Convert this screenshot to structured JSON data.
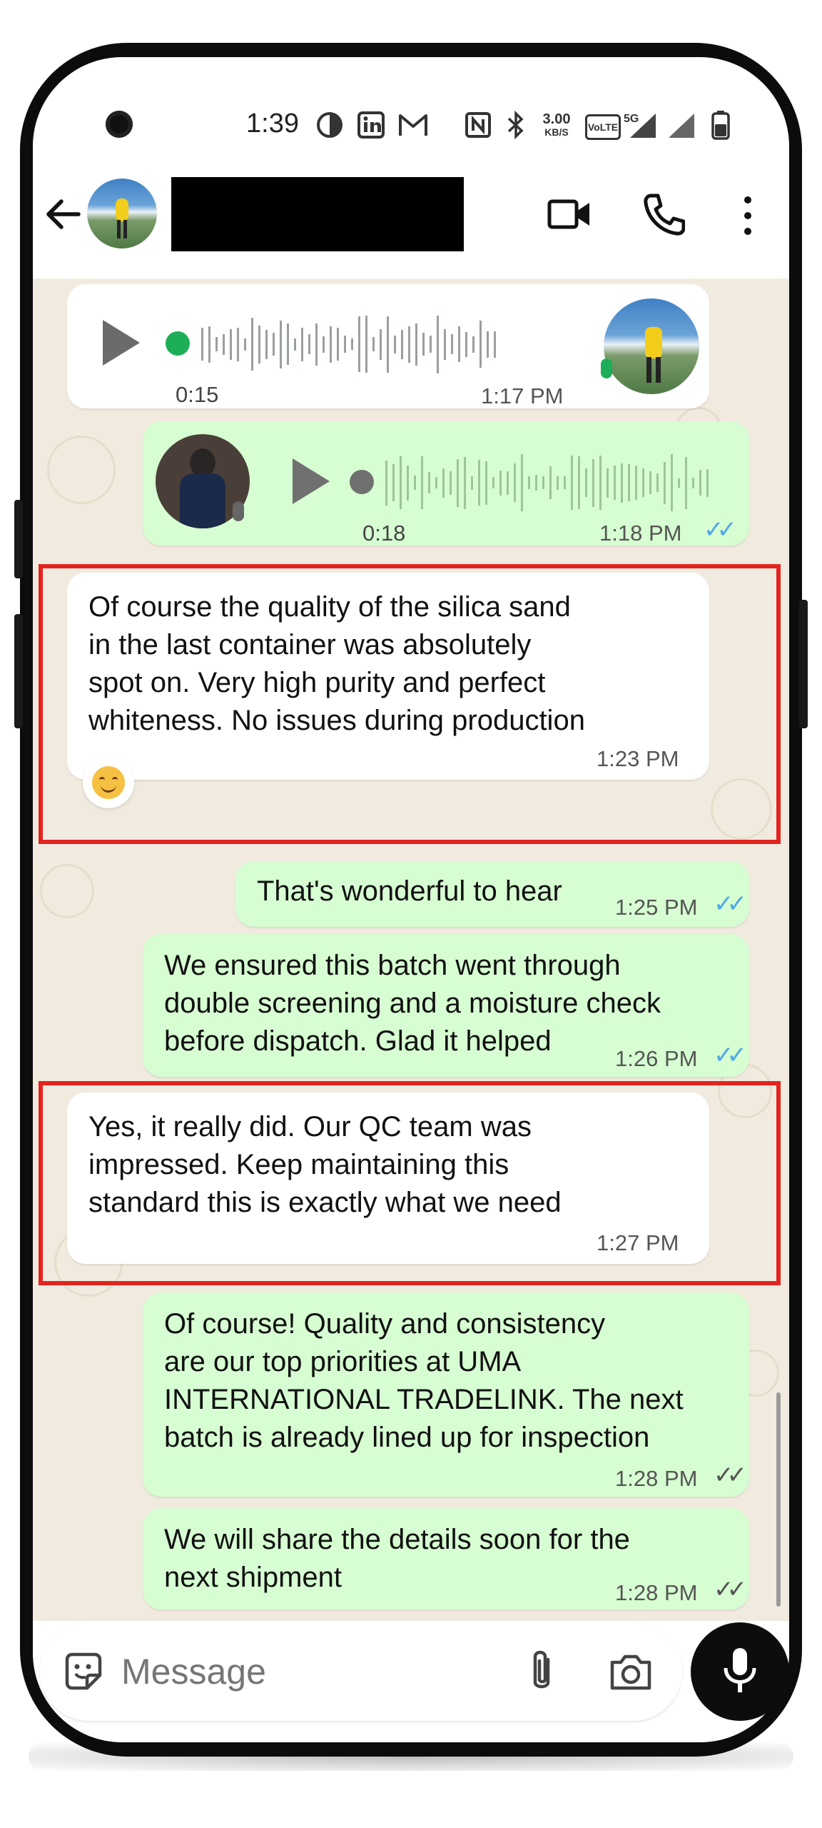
{
  "status_bar": {
    "time": "1:39",
    "icons": [
      "data-saver-icon",
      "linkedin-icon",
      "gmail-icon",
      "nfc-icon",
      "bluetooth-icon",
      "network-speed-icon",
      "volte-icon",
      "5g-signal-icon",
      "signal-icon",
      "battery-icon"
    ],
    "network_speed": "3.00",
    "network_unit": "KB/S",
    "volte_text": "VoLTE",
    "network_type": "5G"
  },
  "header": {
    "back_icon": "back-arrow-icon",
    "contact_name": "",
    "actions": [
      "video-call-icon",
      "voice-call-icon",
      "more-options-icon"
    ]
  },
  "messages": [
    {
      "type": "voice",
      "direction": "in",
      "duration": "0:15",
      "time": "1:17 PM"
    },
    {
      "type": "voice",
      "direction": "out",
      "duration": "0:18",
      "time": "1:18 PM",
      "status": "read"
    },
    {
      "type": "text",
      "direction": "in",
      "text": "Of course the quality of the silica sand\nin the last container was absolutely\nspot on. Very high purity and perfect\nwhiteness. No issues during production",
      "time": "1:23 PM",
      "reaction": "😊",
      "highlighted": true
    },
    {
      "type": "text",
      "direction": "out",
      "text": "That's wonderful to hear",
      "time": "1:25 PM",
      "status": "read"
    },
    {
      "type": "text",
      "direction": "out",
      "text": "We ensured this batch went through\ndouble screening and a moisture check\nbefore dispatch. Glad it helped",
      "time": "1:26 PM",
      "status": "read"
    },
    {
      "type": "text",
      "direction": "in",
      "text": "Yes, it really did. Our QC team was\nimpressed. Keep maintaining this\nstandard this is exactly what we need",
      "time": "1:27 PM",
      "highlighted": true
    },
    {
      "type": "text",
      "direction": "out",
      "text": "Of course! Quality and consistency\nare our top priorities at UMA\nINTERNATIONAL TRADELINK. The next\nbatch is already lined up for inspection",
      "time": "1:28 PM",
      "status": "delivered"
    },
    {
      "type": "text",
      "direction": "out",
      "text": "We will share the details soon for the\nnext shipment",
      "time": "1:28 PM",
      "status": "delivered"
    }
  ],
  "ticks_glyph": "✓✓",
  "input": {
    "placeholder": "Message",
    "icons": [
      "sticker-icon",
      "attach-icon",
      "camera-icon"
    ],
    "send_icon": "mic-icon"
  },
  "colors": {
    "incoming_bubble": "#ffffff",
    "outgoing_bubble": "#d7fdd2",
    "chat_background": "#f1ebdf",
    "read_ticks": "#4fa7e6",
    "highlight_frame": "#e3231f",
    "voice_dot_incoming": "#1eae58"
  }
}
